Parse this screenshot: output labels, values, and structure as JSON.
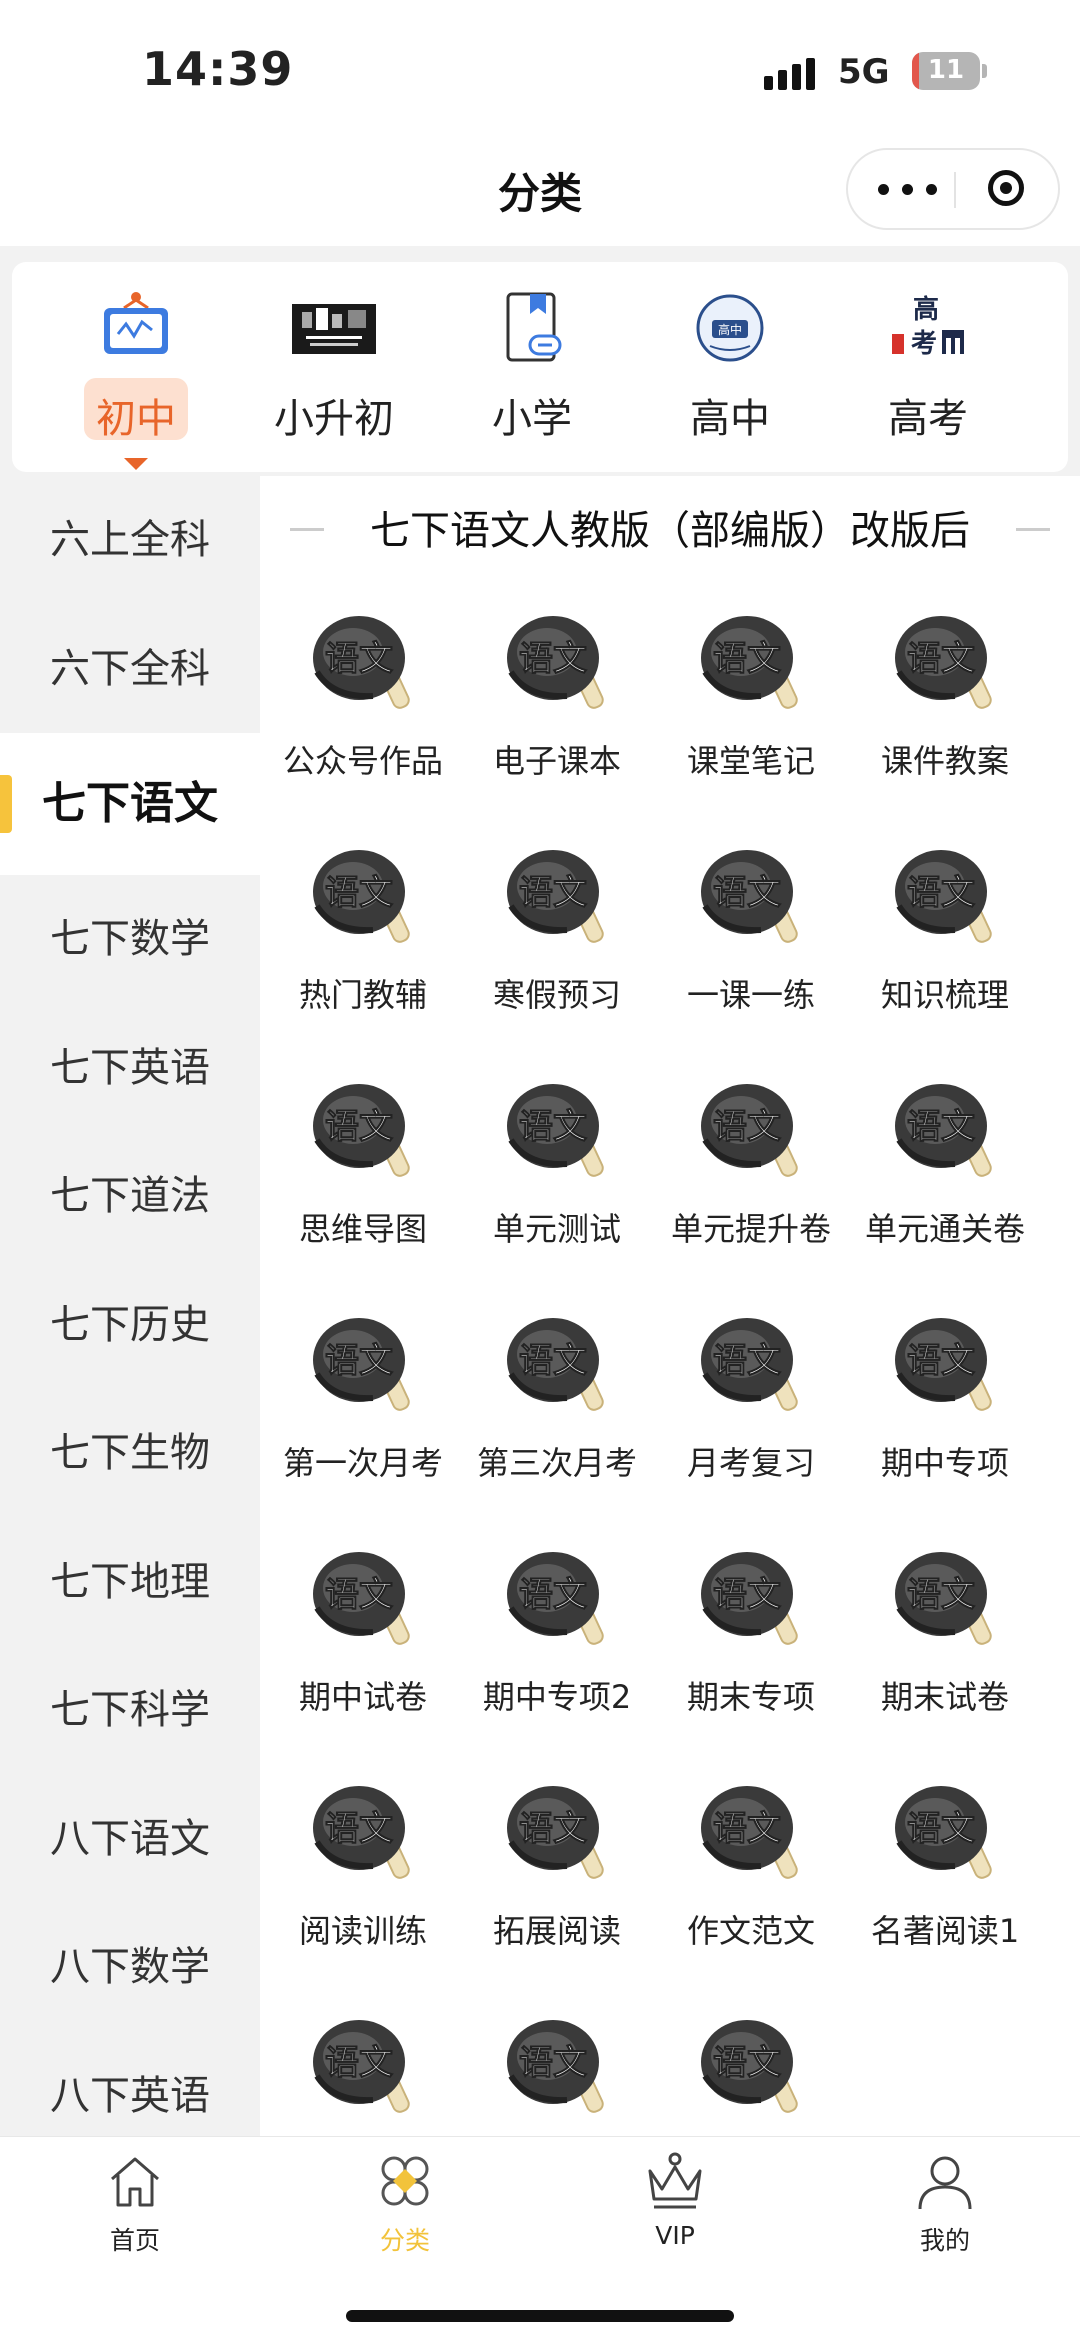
{
  "status_bar": {
    "time": "14:39",
    "network": "5G",
    "battery": "11",
    "battery_level": 0.11
  },
  "nav": {
    "title": "分类"
  },
  "levels": [
    {
      "label": "初中",
      "icon": "whiteboard-icon",
      "active": true
    },
    {
      "label": "小升初",
      "icon": "promo-banner-icon",
      "active": false
    },
    {
      "label": "小学",
      "icon": "bookmark-link-icon",
      "active": false
    },
    {
      "label": "高中",
      "icon": "high-school-badge-icon",
      "active": false
    },
    {
      "label": "高考",
      "icon": "gaokao-building-icon",
      "active": false
    }
  ],
  "sidebar": {
    "items": [
      {
        "label": "六上全科",
        "active": false
      },
      {
        "label": "六下全科",
        "active": false
      },
      {
        "label": "七下语文",
        "active": true
      },
      {
        "label": "七下数学",
        "active": false
      },
      {
        "label": "七下英语",
        "active": false
      },
      {
        "label": "七下道法",
        "active": false
      },
      {
        "label": "七下历史",
        "active": false
      },
      {
        "label": "七下生物",
        "active": false
      },
      {
        "label": "七下地理",
        "active": false
      },
      {
        "label": "七下科学",
        "active": false
      },
      {
        "label": "八下语文",
        "active": false
      },
      {
        "label": "八下数学",
        "active": false
      },
      {
        "label": "八下英语",
        "active": false
      }
    ]
  },
  "section": {
    "title": "七下语文人教版（部编版）改版后",
    "icon_text": "语文",
    "items": [
      {
        "label": "公众号作品"
      },
      {
        "label": "电子课本"
      },
      {
        "label": "课堂笔记"
      },
      {
        "label": "课件教案"
      },
      {
        "label": "热门教辅"
      },
      {
        "label": "寒假预习"
      },
      {
        "label": "一课一练"
      },
      {
        "label": "知识梳理"
      },
      {
        "label": "思维导图"
      },
      {
        "label": "单元测试"
      },
      {
        "label": "单元提升卷"
      },
      {
        "label": "单元通关卷"
      },
      {
        "label": "第一次月考"
      },
      {
        "label": "第三次月考"
      },
      {
        "label": "月考复习"
      },
      {
        "label": "期中专项"
      },
      {
        "label": "期中试卷"
      },
      {
        "label": "期中专项2"
      },
      {
        "label": "期末专项"
      },
      {
        "label": "期末试卷"
      },
      {
        "label": "阅读训练"
      },
      {
        "label": "拓展阅读"
      },
      {
        "label": "作文范文"
      },
      {
        "label": "名著阅读1"
      },
      {
        "label": ""
      },
      {
        "label": ""
      },
      {
        "label": ""
      }
    ]
  },
  "tabbar": {
    "items": [
      {
        "label": "首页",
        "icon": "home-icon",
        "active": false
      },
      {
        "label": "分类",
        "icon": "category-icon",
        "active": true
      },
      {
        "label": "VIP",
        "icon": "crown-icon",
        "active": false
      },
      {
        "label": "我的",
        "icon": "user-icon",
        "active": false
      }
    ]
  },
  "colors": {
    "accent_orange": "#e8652a",
    "accent_yellow": "#f2c33b",
    "sidebar_bg": "#f2f2f2"
  }
}
